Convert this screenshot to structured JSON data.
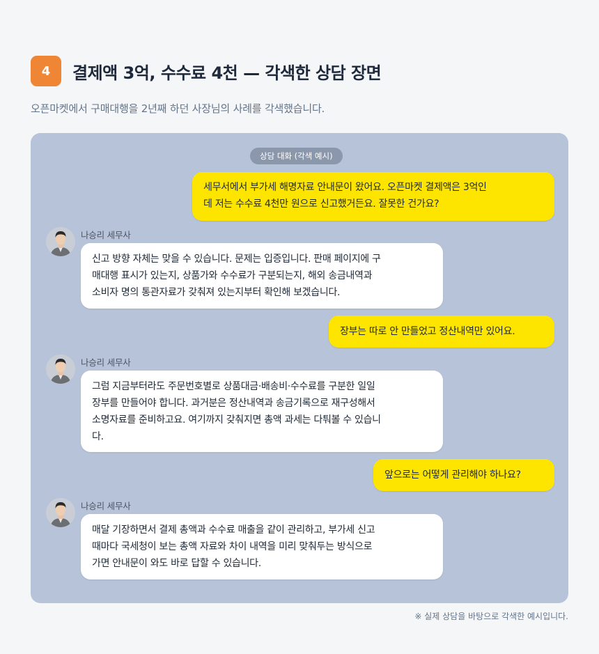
{
  "section": {
    "number": "4",
    "title": "결제액 3억, 수수료 4천 — 각색한 상담 장면",
    "description": "오픈마켓에서 구매대행을 2년째 하던 사장님의 사례를 각색했습니다."
  },
  "chat": {
    "label": "상담 대화 (각색 예시)",
    "messages": [
      {
        "role": "user",
        "lines": [
          "세무서에서 부가세 해명자료 안내문이 왔어요. 오픈마켓 결제액은 3억인",
          "데 저는 수수료 4천만 원으로 신고했거든요. 잘못한 건가요?"
        ]
      },
      {
        "role": "agent",
        "sender": "나승리 세무사",
        "lines": [
          "신고 방향 자체는 맞을 수 있습니다. 문제는 입증입니다. 판매 페이지에 구",
          "매대행 표시가 있는지, 상품가와 수수료가 구분되는지, 해외 송금내역과",
          "소비자 명의 통관자료가 갖춰져 있는지부터 확인해 보겠습니다."
        ]
      },
      {
        "role": "user",
        "lines": [
          "장부는 따로 안 만들었고 정산내역만 있어요."
        ]
      },
      {
        "role": "agent",
        "sender": "나승리 세무사",
        "lines": [
          "그럼 지금부터라도 주문번호별로 상품대금·배송비·수수료를 구분한 일일",
          "장부를 만들어야 합니다. 과거분은 정산내역과 송금기록으로 재구성해서",
          "소명자료를 준비하고요. 여기까지 갖춰지면 총액 과세는 다퉈볼 수 있습니",
          "다."
        ]
      },
      {
        "role": "user",
        "lines": [
          "앞으로는 어떻게 관리해야 하나요?"
        ]
      },
      {
        "role": "agent",
        "sender": "나승리 세무사",
        "lines": [
          "매달 기장하면서 결제 총액과 수수료 매출을 같이 관리하고, 부가세 신고",
          "때마다 국세청이 보는 총액 자료와 차이 내역을 미리 맞춰두는 방식으로",
          "가면 안내문이 와도 바로 답할 수 있습니다."
        ]
      }
    ]
  },
  "footnote": "※ 실제 상담을 바탕으로 각색한 예시입니다.",
  "colors": {
    "badge": "#ef8636",
    "panel": "#b6c3d8",
    "user_bubble": "#fee500",
    "agent_bubble": "#ffffff",
    "label_pill": "#8b97ab"
  },
  "icons": {
    "avatar": "advisor-avatar-icon"
  }
}
